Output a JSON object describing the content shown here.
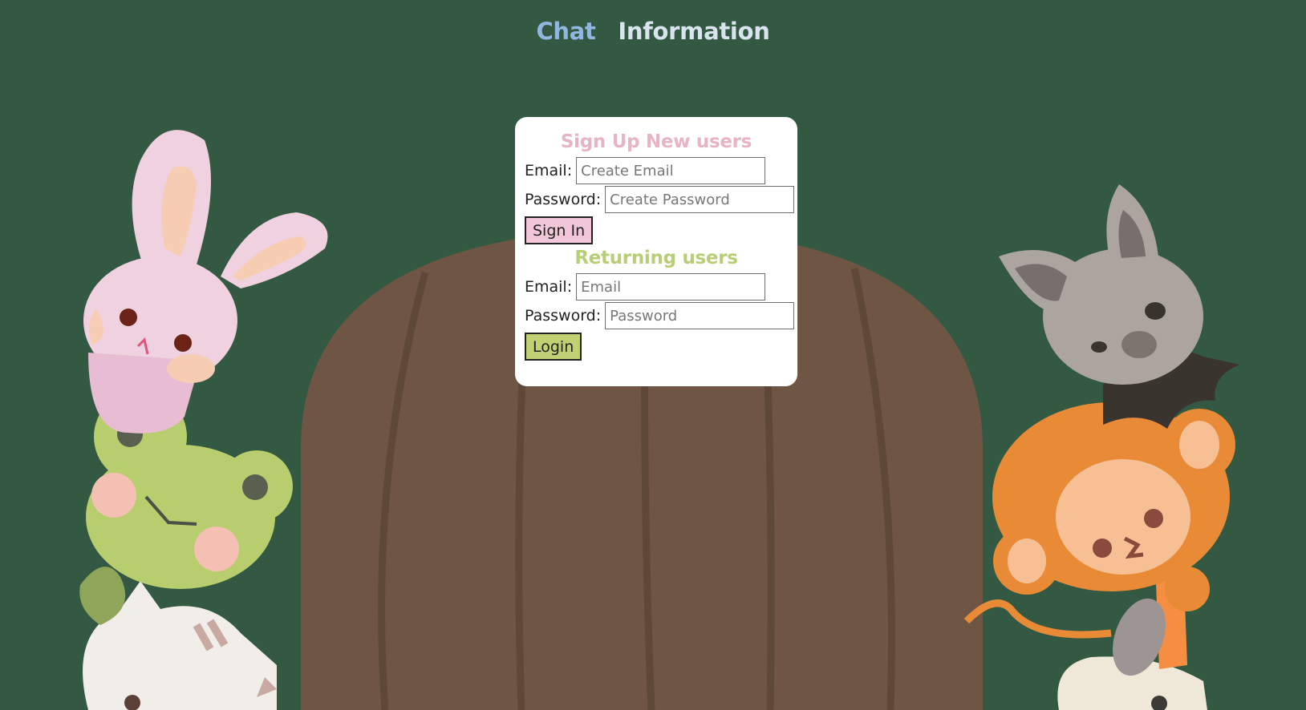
{
  "nav": {
    "chat_label": "Chat",
    "info_label": "Information"
  },
  "signup": {
    "heading": "Sign Up New users",
    "email_label": "Email:",
    "email_placeholder": "Create Email",
    "password_label": "Password:",
    "password_placeholder": "Create Password",
    "button_label": "Sign In"
  },
  "login": {
    "heading": "Returning users",
    "email_label": "Email:",
    "email_placeholder": "Email",
    "password_label": "Password:",
    "password_placeholder": "Password",
    "button_label": "Login"
  },
  "colors": {
    "background": "#345943",
    "door": "#6f5644",
    "chat_link": "#8fb7df",
    "info_link": "#d9e4ee",
    "signup_heading": "#e7b3c7",
    "login_heading": "#b7cd77",
    "signin_button": "#f2c8d8",
    "login_button": "#c1d073"
  },
  "illustrations": [
    "door-illustration",
    "bunny-icon",
    "frog-icon",
    "cat-icon",
    "bat-icon",
    "monkey-icon",
    "sheep-icon"
  ]
}
